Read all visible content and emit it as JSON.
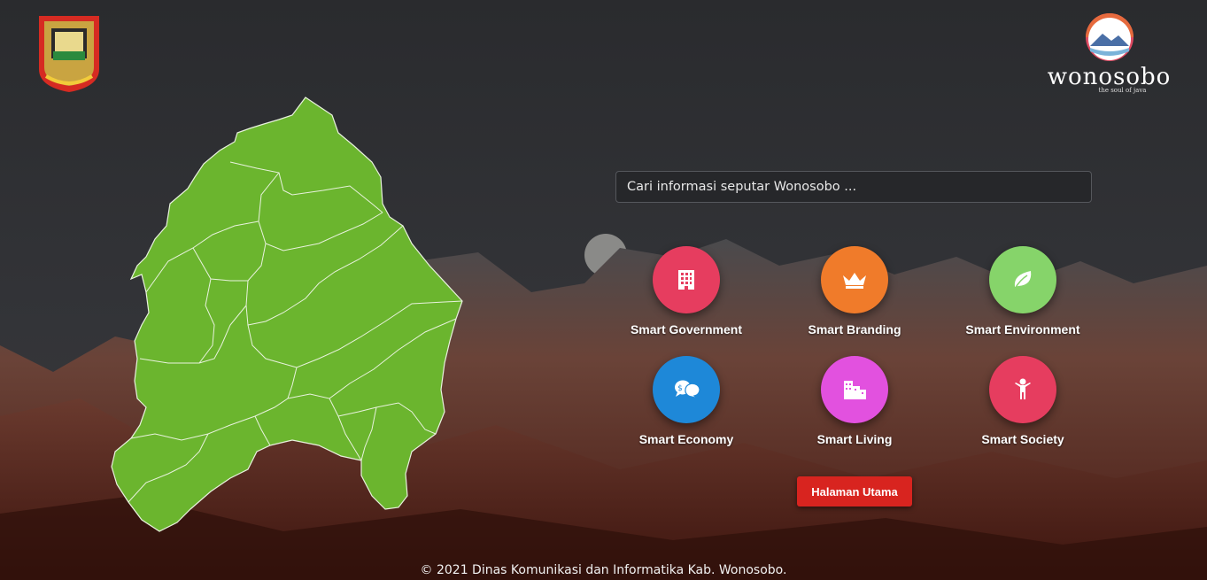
{
  "header": {
    "brand_name": "wonosobo",
    "brand_tagline": "the soul of java"
  },
  "search": {
    "placeholder": "Cari informasi seputar Wonosobo ..."
  },
  "menu": [
    {
      "label": "Smart Government",
      "icon": "building-icon",
      "color": "#e63d5f"
    },
    {
      "label": "Smart Branding",
      "icon": "crown-icon",
      "color": "#f07b2a"
    },
    {
      "label": "Smart Environment",
      "icon": "leaf-icon",
      "color": "#86d46a"
    },
    {
      "label": "Smart Economy",
      "icon": "money-chat-icon",
      "color": "#1e88d8"
    },
    {
      "label": "Smart Living",
      "icon": "city-icon",
      "color": "#e251df"
    },
    {
      "label": "Smart Society",
      "icon": "person-icon",
      "color": "#e63d5f"
    }
  ],
  "home_button": "Halaman Utama",
  "footer": "© 2021 Dinas Komunikasi dan Informatika Kab. Wonosobo.",
  "colors": {
    "map_fill": "#6bb52e",
    "button": "#d8241f"
  }
}
